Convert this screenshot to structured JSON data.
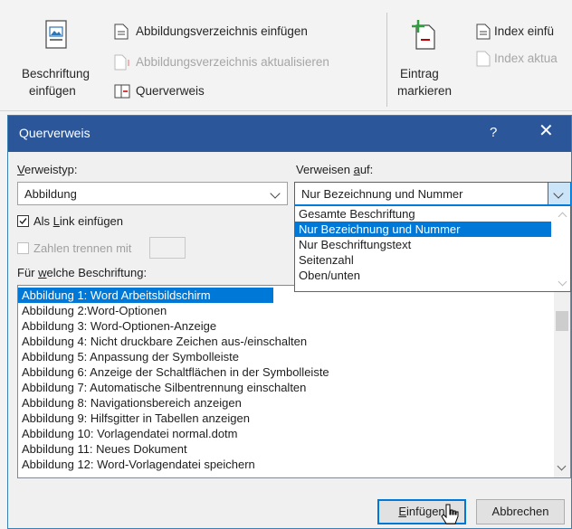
{
  "ribbon": {
    "insert_caption_line1": "Beschriftung",
    "insert_caption_line2": "einfügen",
    "insert_tof": "Abbildungsverzeichnis einfügen",
    "update_tof": "Abbildungsverzeichnis aktualisieren",
    "cross_reference": "Querverweis",
    "mark_entry_line1": "Eintrag",
    "mark_entry_line2": "markieren",
    "insert_index": "Index einfü",
    "update_index": "Index aktua"
  },
  "dialog": {
    "title": "Querverweis",
    "help": "?",
    "close": "✕",
    "ref_type_label_u": "V",
    "ref_type_label_rest": "erweistyp:",
    "ref_type_value": "Abbildung",
    "ref_to_label_pre": "Verweisen ",
    "ref_to_label_u": "a",
    "ref_to_label_rest": "uf:",
    "ref_to_value": "Nur Bezeichnung und Nummer",
    "ref_to_options": [
      "Gesamte Beschriftung",
      "Nur Bezeichnung und Nummer",
      "Nur Beschriftungstext",
      "Seitenzahl",
      "Oben/unten"
    ],
    "insert_link_pre": "Als ",
    "insert_link_u": "L",
    "insert_link_rest": "ink einfügen",
    "separate_numbers": "Zahlen trennen mit",
    "for_caption_pre": "Für ",
    "for_caption_u": "w",
    "for_caption_rest": "elche Beschriftung:",
    "captions": [
      "Abbildung 1: Word Arbeitsbildschirm",
      "Abbildung 2:Word-Optionen",
      "Abbildung 3: Word-Optionen-Anzeige",
      "Abbildung 4: Nicht druckbare Zeichen aus-/einschalten",
      "Abbildung 5: Anpassung der Symbolleiste",
      "Abbildung 6: Anzeige der Schaltflächen in der Symbolleiste",
      "Abbildung 7: Automatische Silbentrennung einschalten",
      "Abbildung 8: Navigationsbereich anzeigen",
      "Abbildung 9: Hilfsgitter in Tabellen anzeigen",
      "Abbildung 10: Vorlagendatei normal.dotm",
      "Abbildung 11: Neues Dokument",
      "Abbildung 12: Word-Vorlagendatei speichern"
    ],
    "insert_btn_u": "E",
    "insert_btn_rest": "infügen",
    "cancel_btn": "Abbrechen"
  },
  "colors": {
    "accent": "#2b579a",
    "selection": "#0078d7"
  }
}
